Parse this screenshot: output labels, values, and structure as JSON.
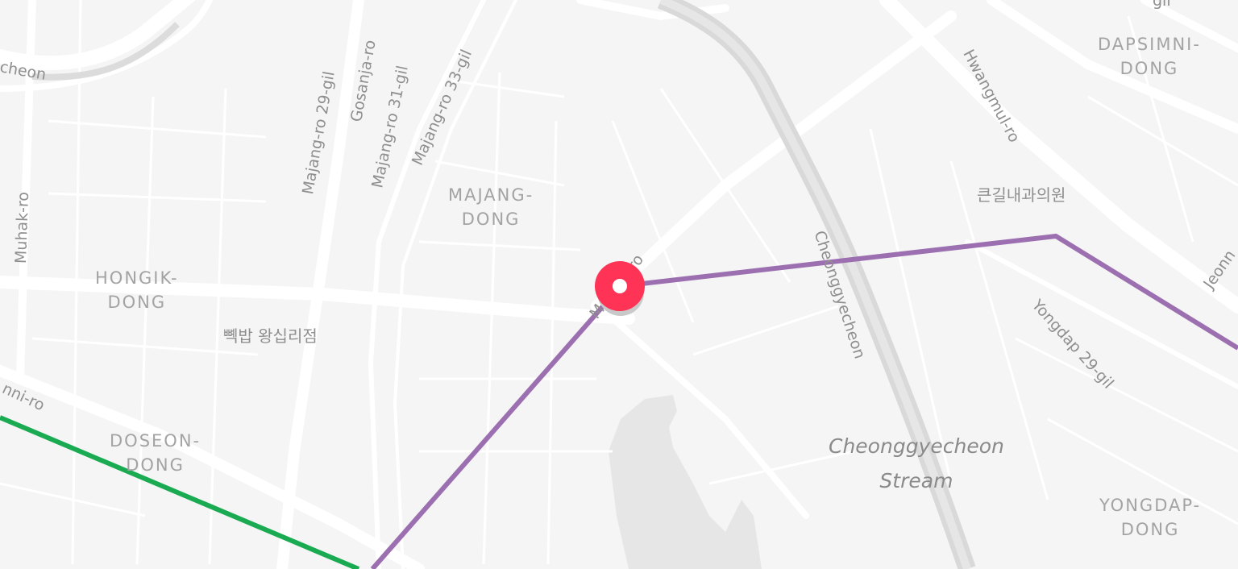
{
  "map": {
    "districts": [
      {
        "id": "majang",
        "lines": [
          "MAJANG-",
          "DONG"
        ]
      },
      {
        "id": "hongik",
        "lines": [
          "HONGIK-",
          "DONG"
        ]
      },
      {
        "id": "doseon",
        "lines": [
          "DOSEON-",
          "DONG"
        ]
      },
      {
        "id": "dapsimni",
        "lines": [
          "DAPSIMNI-",
          "DONG"
        ]
      },
      {
        "id": "yongdap",
        "lines": [
          "YONGDAP-",
          "DONG"
        ]
      }
    ],
    "streets": {
      "majang_ro_29_gil": "Majang-ro 29-gil",
      "gosanja_ro": "Gosanja-ro",
      "majang_ro_31_gil": "Majang-ro 31-gil",
      "majang_ro_33_gil": "Majang-ro 33-gil",
      "muhak_ro": "Muhak-ro",
      "hwangmul_ro": "Hwangmul-ro",
      "cheonggyecheon_road": "Cheonggyecheon",
      "yongdap_29_gil": "Yongdap 29-gil",
      "majang_ro": "Majang-ro",
      "wangsimni_ro": "nni-ro",
      "cheon_top": "cheon",
      "jeonn": "Jeonn",
      "gil_top": "gil"
    },
    "pois": {
      "bbekbap": "뼥밥 왕십리점",
      "keungil_clinic": "큰길내과의원"
    },
    "water": {
      "stream_lines": [
        "Cheonggyecheon",
        "Stream"
      ]
    },
    "routes": [
      {
        "name": "purple-route",
        "color": "#9b6fb0"
      },
      {
        "name": "green-route",
        "color": "#1aab52"
      }
    ],
    "marker": {
      "color": "#ff3355",
      "icon": "location-pin-icon"
    }
  }
}
